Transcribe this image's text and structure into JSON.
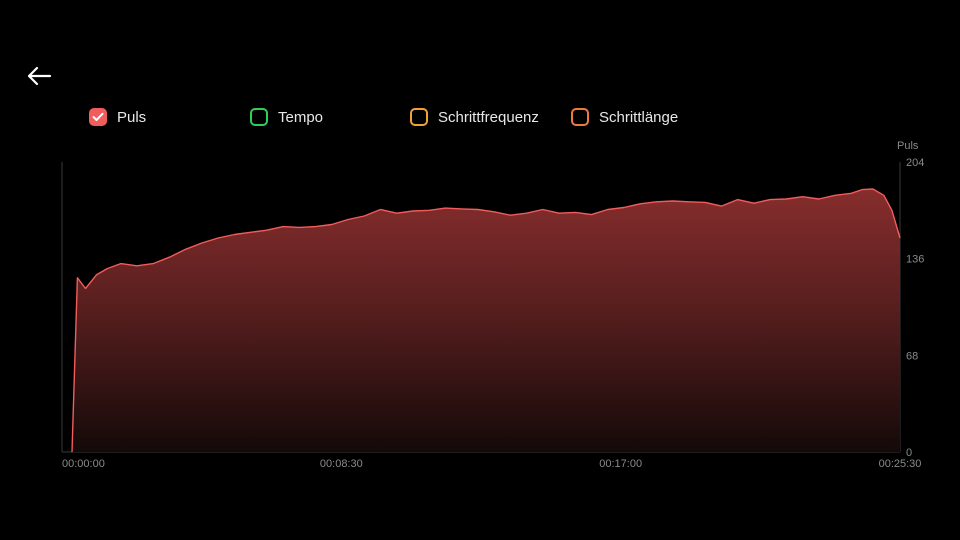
{
  "nav": {
    "back_icon": "arrow-left-icon"
  },
  "legend": [
    {
      "label": "Puls",
      "color": "#f25c5c",
      "checked": true
    },
    {
      "label": "Tempo",
      "color": "#2fce5a",
      "checked": false
    },
    {
      "label": "Schrittfrequenz",
      "color": "#f0a236",
      "checked": false
    },
    {
      "label": "Schrittlänge",
      "color": "#ee7a3c",
      "checked": false
    }
  ],
  "chart_data": {
    "type": "area",
    "series": [
      {
        "name": "Puls",
        "color": "#f25c5c",
        "x": [
          "00:00:00",
          "00:00:10",
          "00:00:25",
          "00:00:45",
          "00:01:05",
          "00:01:30",
          "00:02:00",
          "00:02:30",
          "00:03:00",
          "00:03:30",
          "00:04:00",
          "00:04:30",
          "00:05:00",
          "00:05:30",
          "00:06:00",
          "00:06:30",
          "00:07:00",
          "00:07:30",
          "00:08:00",
          "00:08:30",
          "00:09:00",
          "00:09:30",
          "00:10:00",
          "00:10:30",
          "00:11:00",
          "00:11:30",
          "00:12:00",
          "00:12:30",
          "00:13:00",
          "00:13:30",
          "00:14:00",
          "00:14:30",
          "00:15:00",
          "00:15:30",
          "00:16:00",
          "00:16:30",
          "00:17:00",
          "00:17:30",
          "00:18:00",
          "00:18:30",
          "00:19:00",
          "00:19:30",
          "00:20:00",
          "00:20:30",
          "00:21:00",
          "00:21:30",
          "00:22:00",
          "00:22:30",
          "00:23:00",
          "00:23:30",
          "00:24:00",
          "00:24:20",
          "00:24:40",
          "00:25:00",
          "00:25:15",
          "00:25:30"
        ],
        "values": [
          0,
          122,
          115,
          124,
          129,
          132,
          131,
          132,
          137,
          142,
          147,
          150,
          153,
          154,
          156,
          158,
          158,
          158,
          160,
          163,
          166,
          170,
          168,
          169,
          170,
          171,
          171,
          170,
          169,
          166,
          168,
          170,
          168,
          168,
          167,
          170,
          172,
          174,
          176,
          176,
          176,
          175,
          173,
          177,
          175,
          177,
          178,
          179,
          178,
          180,
          182,
          184,
          185,
          180,
          170,
          150
        ]
      }
    ],
    "xticks": [
      "00:00:00",
      "00:08:30",
      "00:17:00",
      "00:25:30"
    ],
    "yticks": [
      0,
      68,
      136,
      204
    ],
    "ylabel": "Puls",
    "ylim": [
      0,
      204
    ],
    "xlim_seconds": [
      0,
      1530
    ],
    "grid": false,
    "legend_position": "top"
  }
}
